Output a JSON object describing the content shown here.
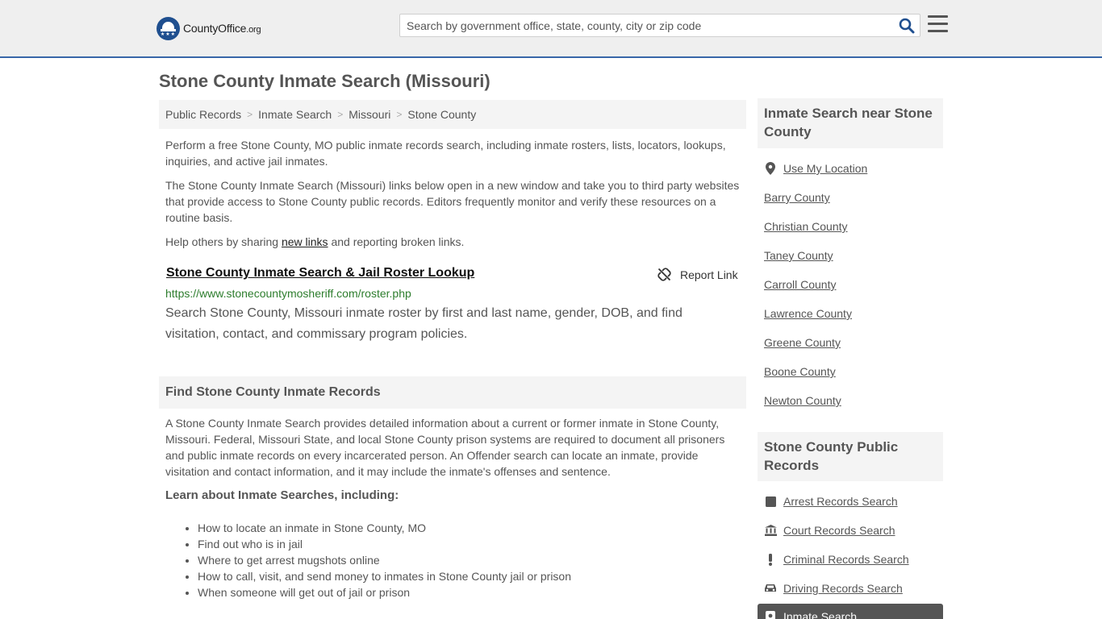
{
  "header": {
    "logo_brand": "CountyOffice",
    "logo_tld": ".org",
    "logo_stars": "★★★",
    "search_placeholder": "Search by government office, state, county, city or zip code"
  },
  "page": {
    "title": "Stone County Inmate Search (Missouri)"
  },
  "breadcrumb": [
    {
      "label": "Public Records"
    },
    {
      "label": "Inmate Search"
    },
    {
      "label": "Missouri"
    },
    {
      "label": "Stone County"
    }
  ],
  "breadcrumb_sep": ">",
  "intro": {
    "p1": "Perform a free Stone County, MO public inmate records search, including inmate rosters, lists, locators, lookups, inquiries, and active jail inmates.",
    "p2": "The Stone County Inmate Search (Missouri) links below open in a new window and take you to third party websites that provide access to Stone County public records. Editors frequently monitor and verify these resources on a routine basis.",
    "p3_before": "Help others by sharing ",
    "p3_link": "new links",
    "p3_after": " and reporting broken links."
  },
  "result": {
    "title": "Stone County Inmate Search & Jail Roster Lookup",
    "url": "https://www.stonecountymosheriff.com/roster.php",
    "description": "Search Stone County, Missouri inmate roster by first and last name, gender, DOB, and find visitation, contact, and commissary program policies.",
    "report_label": "Report Link"
  },
  "section": {
    "heading": "Find Stone County Inmate Records",
    "paragraph": "A Stone County Inmate Search provides detailed information about a current or former inmate in Stone County, Missouri. Federal, Missouri State, and local Stone County prison systems are required to document all prisoners and public inmate records on every incarcerated person. An Offender search can locate an inmate, provide visitation and contact information, and it may include the inmate's offenses and sentence.",
    "learn_heading": "Learn about Inmate Searches, including:",
    "learn_items": [
      "How to locate an inmate in Stone County, MO",
      "Find out who is in jail",
      "Where to get arrest mugshots online",
      "How to call, visit, and send money to inmates in Stone County jail or prison",
      "When someone will get out of jail or prison"
    ]
  },
  "sidebar": {
    "nearby_heading": "Inmate Search near Stone County",
    "use_location": "Use My Location",
    "nearby": [
      "Barry County",
      "Christian County",
      "Taney County",
      "Carroll County",
      "Lawrence County",
      "Greene County",
      "Boone County",
      "Newton County"
    ],
    "records_heading": "Stone County Public Records",
    "records": [
      {
        "label": "Arrest Records Search",
        "icon": "square-icon"
      },
      {
        "label": "Court Records Search",
        "icon": "courthouse-icon"
      },
      {
        "label": "Criminal Records Search",
        "icon": "exclamation-icon"
      },
      {
        "label": "Driving Records Search",
        "icon": "car-icon"
      },
      {
        "label": "Inmate Search",
        "icon": "badge-icon"
      }
    ]
  }
}
